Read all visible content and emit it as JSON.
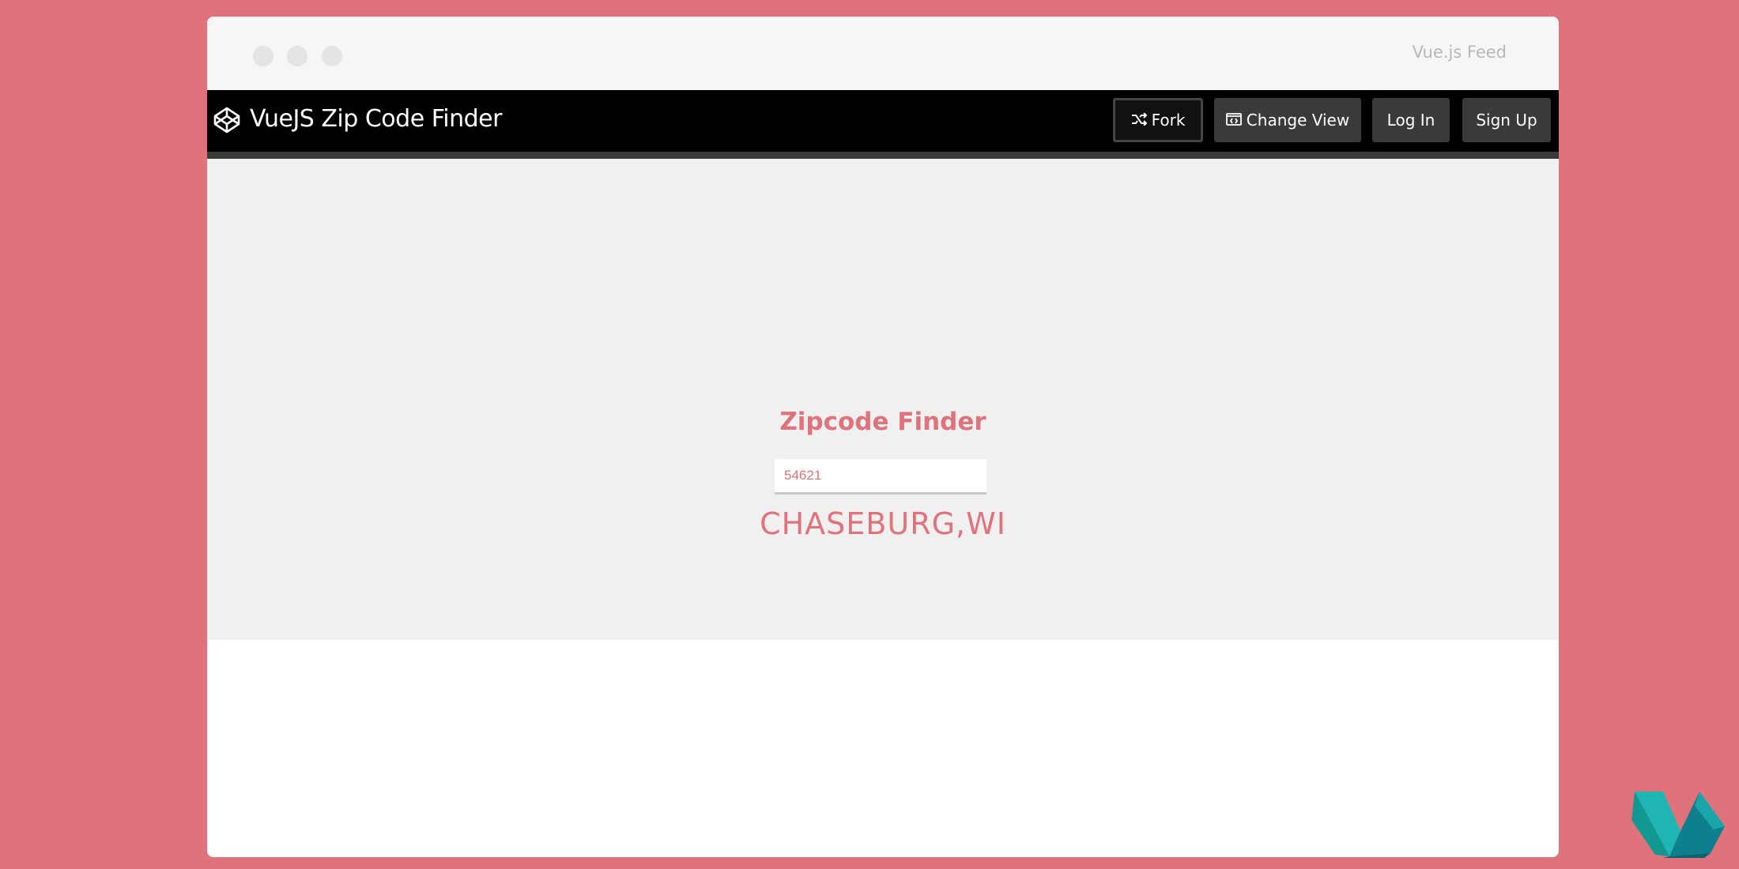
{
  "window": {
    "feed_title": "Vue.js Feed"
  },
  "navbar": {
    "title": "VueJS Zip Code Finder",
    "fork_label": "Fork",
    "change_view_label": "Change View",
    "login_label": "Log In",
    "signup_label": "Sign Up"
  },
  "app": {
    "title": "Zipcode Finder",
    "zip_value": "54621",
    "result": "CHASEBURG,WI"
  },
  "colors": {
    "background": "#e0727b",
    "accent": "#e0727b",
    "navbar": "#000000",
    "button": "#3a3a3a"
  },
  "icons": {
    "logo": "codepen-logo-icon",
    "fork": "fork-icon",
    "change_view": "change-view-icon",
    "corner": "vue-feed-logo-icon"
  }
}
